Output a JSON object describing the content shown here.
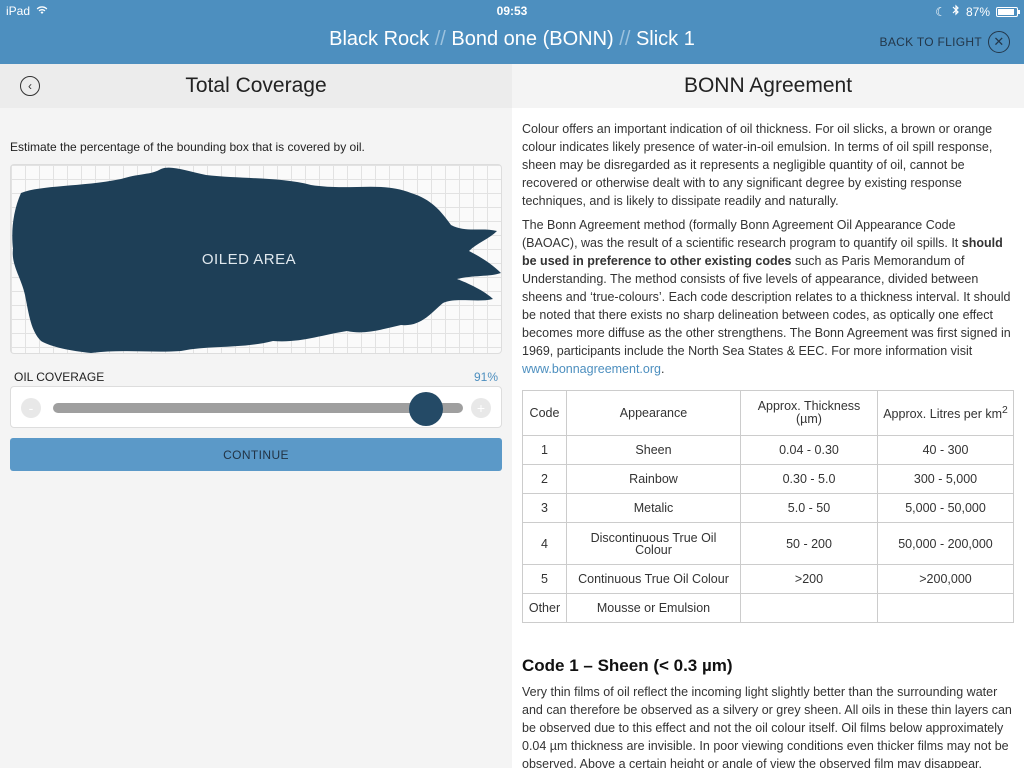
{
  "status": {
    "device": "iPad",
    "time": "09:53",
    "battery": "87%",
    "battery_level": 0.87
  },
  "nav": {
    "crumbs": [
      "Black Rock",
      "Bond one (BONN)",
      "Slick 1"
    ],
    "separator": "//",
    "back_to_flight": "BACK TO FLIGHT"
  },
  "left": {
    "title": "Total Coverage",
    "instruction": "Estimate the percentage of the bounding box that is covered by oil.",
    "oiled_label": "OILED AREA",
    "coverage_label": "OIL COVERAGE",
    "coverage_value": "91%",
    "coverage_level": 0.91,
    "minus": "-",
    "plus": "+",
    "continue": "CONTINUE"
  },
  "right": {
    "title": "BONN Agreement",
    "p1": "Colour offers an important indication of oil thickness. For oil slicks, a brown or orange colour indicates likely presence of water-in-oil emulsion. In terms of oil spill response, sheen may be disregarded as it represents a negligible quantity of oil, cannot be recovered or otherwise dealt with to any significant degree by existing response techniques, and is likely to dissipate readily and naturally.",
    "p2_a": "The Bonn Agreement method (formally Bonn Agreement Oil Appearance Code (BAOAC), was the result of a scientific research program to quantify oil spills. It ",
    "p2_bold": "should be used in preference to other existing codes",
    "p2_b": " such as Paris Memorandum of Understanding. The method consists of five levels of appearance, divided between sheens and ‘true-colours’. Each code description relates to a thickness interval. It should be noted that there exists no sharp delineation between codes, as optically one effect becomes more diffuse as the other strengthens. The Bonn Agreement was first signed in 1969, participants include the North Sea States & EEC. For more information visit ",
    "link": "www.bonnagreement.org",
    "p2_end": ".",
    "table": {
      "headers": [
        "Code",
        "Appearance",
        "Approx. Thickness (µm)",
        "Approx. Litres per km",
        "2"
      ],
      "rows": [
        [
          "1",
          "Sheen",
          "0.04 - 0.30",
          "40 - 300"
        ],
        [
          "2",
          "Rainbow",
          "0.30 - 5.0",
          "300 - 5,000"
        ],
        [
          "3",
          "Metalic",
          "5.0 - 50",
          "5,000 - 50,000"
        ],
        [
          "4",
          "Discontinuous True Oil Colour",
          "50 - 200",
          "50,000 - 200,000"
        ],
        [
          "5",
          "Continuous True Oil Colour",
          ">200",
          ">200,000"
        ],
        [
          "Other",
          "Mousse or Emulsion",
          "",
          ""
        ]
      ]
    },
    "code1_heading": "Code 1 – Sheen (< 0.3 µm)",
    "code1_text": "Very thin films of oil reflect the incoming light slightly better than the surrounding water and can therefore be observed as a silvery or grey sheen. All oils in these thin layers can be observed due to this effect and not the oil colour itself. Oil films below approximately 0.04 µm thickness are invisible. In poor viewing conditions even thicker films may not be observed. Above a certain height or angle of view the observed film may disappear."
  },
  "colors": {
    "header": "#4d8fbf",
    "oil": "#1e3f57",
    "thumb": "#244a66",
    "button": "#5b99c8"
  }
}
